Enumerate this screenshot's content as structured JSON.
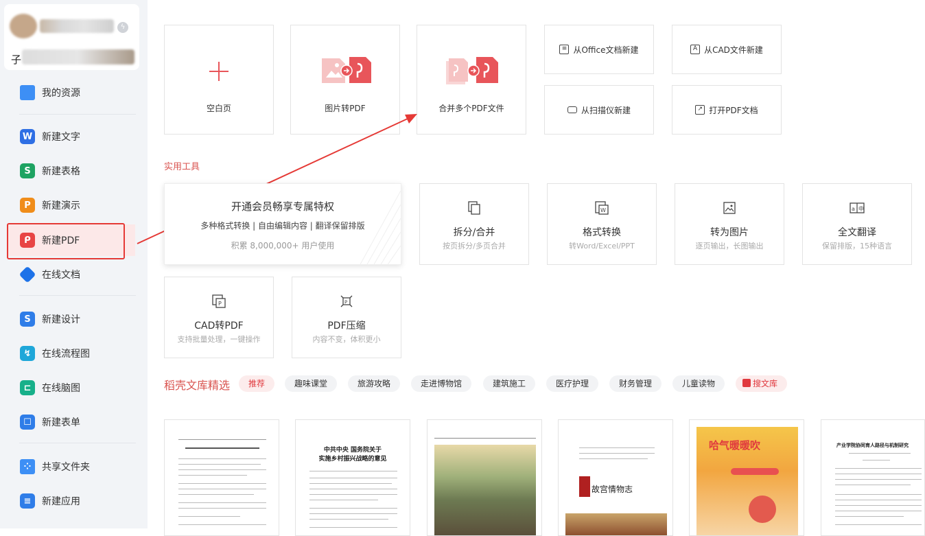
{
  "sidebar": {
    "profile_char": "子",
    "items": [
      {
        "label": "我的资源",
        "icon": "folder-icon",
        "color": "#3d8ff5"
      },
      {
        "label": "新建文字",
        "icon": "word-icon",
        "color": "#2f6fe4"
      },
      {
        "label": "新建表格",
        "icon": "sheet-icon",
        "color": "#1ea362"
      },
      {
        "label": "新建演示",
        "icon": "slides-icon",
        "color": "#f08d1a"
      },
      {
        "label": "新建PDF",
        "icon": "pdf-icon",
        "color": "#e84545"
      },
      {
        "label": "在线文档",
        "icon": "online-doc-icon",
        "color": "#1d72e8"
      },
      {
        "label": "新建设计",
        "icon": "design-icon",
        "color": "#2f7de8"
      },
      {
        "label": "在线流程图",
        "icon": "flowchart-icon",
        "color": "#1fa7d9"
      },
      {
        "label": "在线脑图",
        "icon": "mindmap-icon",
        "color": "#17b08a"
      },
      {
        "label": "新建表单",
        "icon": "form-icon",
        "color": "#2f7de8"
      },
      {
        "label": "共享文件夹",
        "icon": "shared-folder-icon",
        "color": "#3d8ff5"
      },
      {
        "label": "新建应用",
        "icon": "app-icon",
        "color": "#2f7de8"
      }
    ]
  },
  "create": {
    "blank": "空白页",
    "image_to_pdf": "图片转PDF",
    "merge_pdf": "合并多个PDF文件",
    "from_office": "从Office文档新建",
    "from_cad": "从CAD文件新建",
    "from_scanner": "从扫描仪新建",
    "open_pdf": "打开PDF文档"
  },
  "tools": {
    "section_title": "实用工具",
    "promo": {
      "title": "开通会员畅享专属特权",
      "subtitle": "多种格式转换 | 自由编辑内容 | 翻译保留排版",
      "count": "积累 8,000,000+ 用户使用"
    },
    "items": [
      {
        "name": "拆分/合并",
        "desc": "按页拆分/多页合并",
        "icon": "split-merge-icon"
      },
      {
        "name": "格式转换",
        "desc": "转Word/Excel/PPT",
        "icon": "format-convert-icon"
      },
      {
        "name": "转为图片",
        "desc": "逐页输出，长图输出",
        "icon": "to-image-icon"
      },
      {
        "name": "全文翻译",
        "desc": "保留排版，15种语言",
        "icon": "translate-icon"
      },
      {
        "name": "CAD转PDF",
        "desc": "支持批量处理，一键操作",
        "icon": "cad-to-pdf-icon"
      },
      {
        "name": "PDF压缩",
        "desc": "内容不变，体积更小",
        "icon": "pdf-compress-icon"
      }
    ]
  },
  "library": {
    "title": "稻壳文库精选",
    "tags": [
      "推荐",
      "趣味课堂",
      "旅游攻略",
      "走进博物馆",
      "建筑施工",
      "医疗护理",
      "财务管理",
      "儿童读物",
      "搜文库"
    ],
    "doc_texts": {
      "doc2_heading": "中共中央 国务院关于\n实施乡村振兴战略的意见",
      "doc4_title": "故宫情物志",
      "doc5_title": "哈气暖暖吹",
      "doc6_title": "产业学院协同育人路径与机制研究"
    }
  },
  "colors": {
    "accent": "#e53935",
    "pdf_pink": "#f28b8b",
    "pdf_red": "#e8555a"
  }
}
